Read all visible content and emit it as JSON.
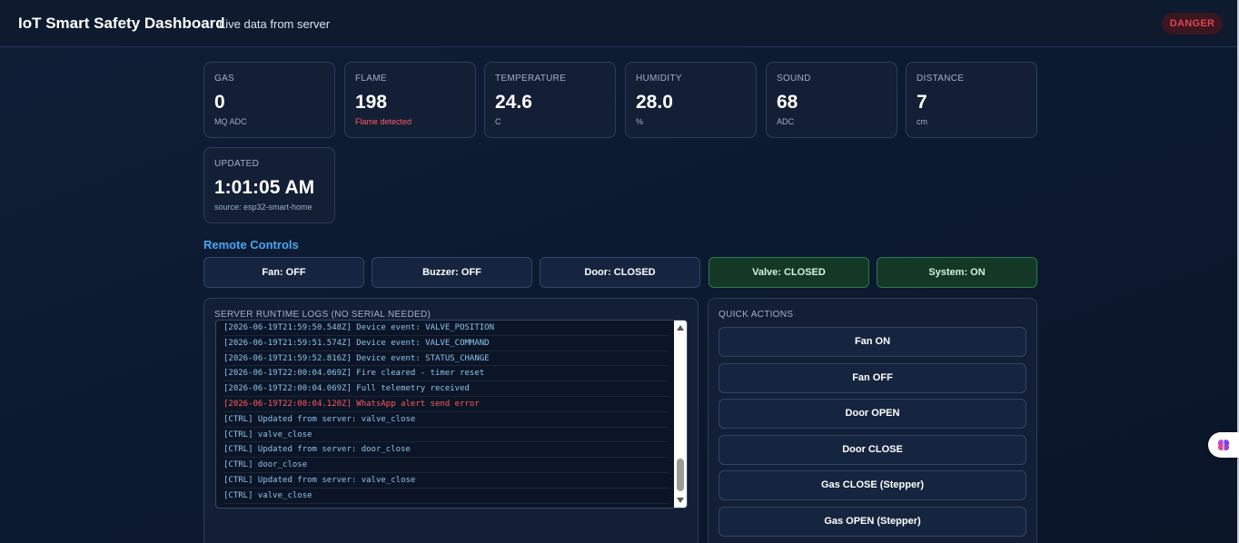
{
  "header": {
    "title": "IoT Smart Safety Dashboard",
    "subtitle": "Live data from server",
    "status_badge": "DANGER"
  },
  "metrics": [
    {
      "label": "GAS",
      "value": "0",
      "sub": "MQ ADC"
    },
    {
      "label": "FLAME",
      "value": "198",
      "sub": "Flame detected"
    },
    {
      "label": "TEMPERATURE",
      "value": "24.6",
      "sub": "C"
    },
    {
      "label": "HUMIDITY",
      "value": "28.0",
      "sub": "%"
    },
    {
      "label": "SOUND",
      "value": "68",
      "sub": "ADC"
    },
    {
      "label": "DISTANCE",
      "value": "7",
      "sub": "cm"
    }
  ],
  "updated": {
    "label": "UPDATED",
    "value": "1:01:05 AM",
    "sub": "source: esp32-smart-home"
  },
  "remote_controls": {
    "title": "Remote Controls",
    "buttons": [
      "Fan: OFF",
      "Buzzer: OFF",
      "Door: CLOSED",
      "Valve: CLOSED",
      "System: ON"
    ]
  },
  "logs": {
    "title": "SERVER RUNTIME LOGS (NO SERIAL NEEDED)",
    "lines": [
      "[2026-06-19T21:59:50.548Z] Device event: VALVE_POSITION",
      "[2026-06-19T21:59:51.574Z] Device event: VALVE_COMMAND",
      "[2026-06-19T21:59:52.816Z] Device event: STATUS_CHANGE",
      "[2026-06-19T22:00:04.069Z] Fire cleared - timer reset",
      "[2026-06-19T22:00:04.069Z] Full telemetry received",
      "[2026-06-19T22:00:04.120Z] WhatsApp alert send error",
      "[CTRL] Updated from server: valve_close",
      "[CTRL] valve_close",
      "[CTRL] Updated from server: door_close",
      "[CTRL] door_close",
      "[CTRL] Updated from server: valve_close",
      "[CTRL] valve_close"
    ]
  },
  "quick_actions": {
    "title": "QUICK ACTIONS",
    "buttons": [
      "Fan ON",
      "Fan OFF",
      "Door OPEN",
      "Door CLOSE",
      "Gas CLOSE (Stepper)",
      "Gas OPEN (Stepper)"
    ]
  },
  "colors": {
    "accent": "#4aa6f0",
    "danger": "#e0454f",
    "active_green": "#2c7a4f"
  }
}
